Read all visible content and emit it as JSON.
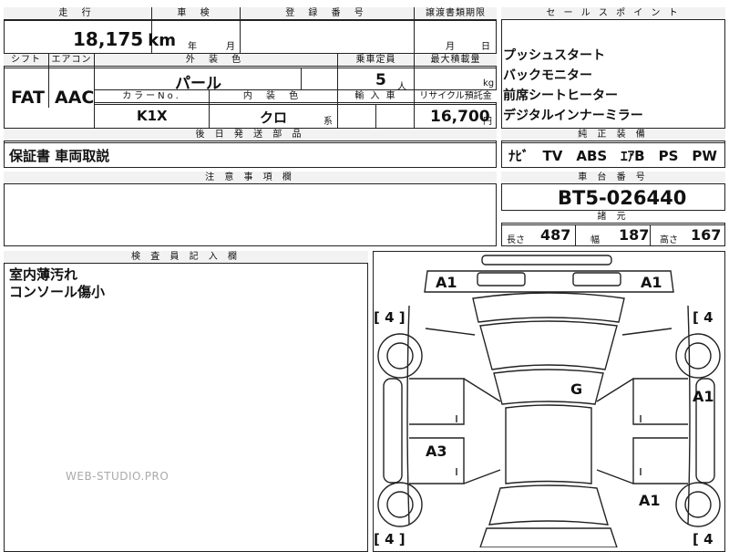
{
  "top_table": {
    "mileage_label": "走 行",
    "mileage_value": "18,175",
    "mileage_unit": "km",
    "inspection_label": "車 検",
    "inspection_year": "年",
    "inspection_month": "月",
    "registration_label": "登 録 番 号",
    "transfer_label": "譲渡書類期限",
    "transfer_month": "月",
    "transfer_day": "日",
    "shift_label": "シフト",
    "aircon_label": "エアコン",
    "exterior_color_label": "外 装 色",
    "capacity_label": "乗車定員",
    "max_load_label": "最大積載量",
    "shift_value": "FAT",
    "aircon_value": "AAC",
    "exterior_color_value": "パール",
    "capacity_value": "5",
    "capacity_unit": "人",
    "max_load_unit": "kg",
    "color_no_label": "カラーNo.",
    "interior_color_label": "内 装 色",
    "import_label": "輸 入 車",
    "recycle_label": "リサイクル預託金",
    "color_no_value": "K1X",
    "interior_color_value": "クロ",
    "interior_suffix": "系",
    "recycle_value": "16,700",
    "recycle_unit": "円",
    "later_parts_label": "後 日 発 送 部 品",
    "later_parts_value": "保証書 車両取説"
  },
  "sales_points": {
    "label": "セ ー ル ス ポ イ ン ト",
    "items": [
      "プッシュスタート",
      "バックモニター",
      "前席シートヒーター",
      "デジタルインナーミラー"
    ]
  },
  "equipment": {
    "label": "純 正 装 備",
    "value": "ﾅﾋﾞ　TV　ABS　ｴｱB　PS　PW"
  },
  "notes": {
    "label": "注 意 事 項 欄",
    "value": ""
  },
  "chassis": {
    "label": "車 台 番 号",
    "value": "BT5-026440"
  },
  "dimensions": {
    "label": "諸 元",
    "length_label": "長さ",
    "length_value": "487",
    "width_label": "幅",
    "width_value": "187",
    "height_label": "高さ",
    "height_value": "167"
  },
  "inspector": {
    "label": "検 査 員 記 入 欄",
    "lines": [
      "室内薄汚れ",
      "コンソール傷小"
    ]
  },
  "diagram_marks": {
    "a1_top_left": "A1",
    "a1_top_right": "A1",
    "tire_fl": "[ 4 ]",
    "tire_fr": "[ 4",
    "g_center": "G",
    "a1_right": "A1",
    "a3_left": "A3",
    "a1_rear_right": "A1",
    "tire_rl": "[ 4 ]",
    "tire_rr": "[ 4"
  },
  "watermark": "WEB-STUDIO.PRO"
}
